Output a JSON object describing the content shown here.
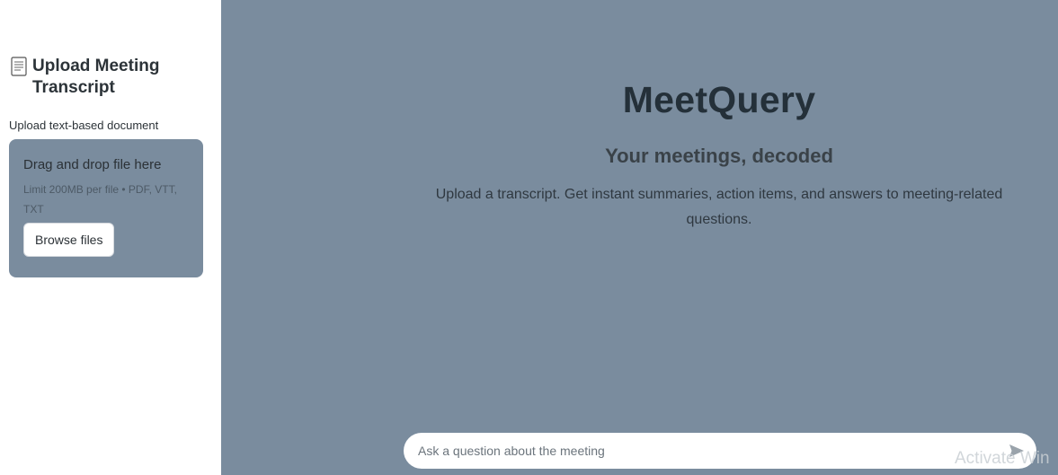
{
  "sidebar": {
    "title": "Upload Meeting Transcript",
    "title_icon": "document-icon",
    "upload_label": "Upload text-based document",
    "dropzone": {
      "title": "Drag and drop file here",
      "limit": "Limit 200MB per file • PDF, VTT, TXT",
      "browse_label": "Browse files"
    }
  },
  "main": {
    "title": "MeetQuery",
    "subtitle": "Your meetings, decoded",
    "description": "Upload a transcript. Get instant summaries, action items, and answers to meeting-related questions."
  },
  "chat": {
    "placeholder": "Ask a question about the meeting",
    "send_icon": "send-icon"
  },
  "watermark": "Activate Win",
  "colors": {
    "background": "#7a8c9e",
    "sidebar": "#ffffff",
    "title_text": "#243039"
  }
}
